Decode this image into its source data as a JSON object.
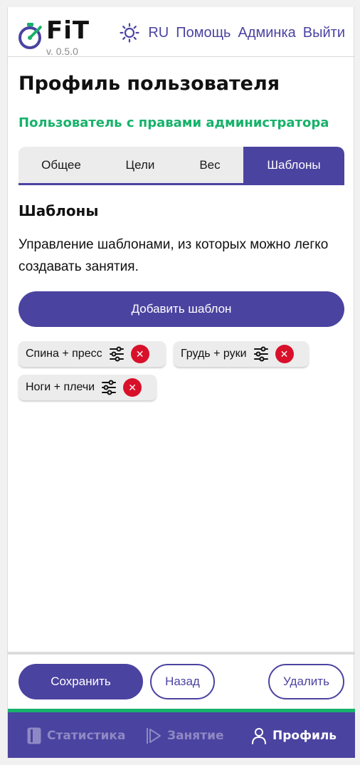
{
  "header": {
    "logo_text": "FiT",
    "version": "v. 0.5.0",
    "theme_icon": "sun-icon",
    "nav": [
      "RU",
      "Помощь",
      "Админка",
      "Выйти"
    ]
  },
  "page": {
    "title": "Профиль пользователя",
    "admin_note": "Пользователь с правами администратора"
  },
  "tabs": [
    {
      "label": "Общее",
      "active": false
    },
    {
      "label": "Цели",
      "active": false
    },
    {
      "label": "Вес",
      "active": false
    },
    {
      "label": "Шаблоны",
      "active": true
    }
  ],
  "templates_section": {
    "title": "Шаблоны",
    "description": "Управление шаблонами, из которых можно легко создавать занятия.",
    "add_button": "Добавить шаблон",
    "items": [
      {
        "name": "Спина + пресс",
        "icons": [
          "sliders-icon",
          "delete-icon"
        ]
      },
      {
        "name": "Грудь + руки",
        "icons": [
          "sliders-icon",
          "delete-icon"
        ]
      },
      {
        "name": "Ноги + плечи",
        "icons": [
          "sliders-icon",
          "delete-icon"
        ]
      }
    ]
  },
  "actions": {
    "save": "Сохранить",
    "back": "Назад",
    "delete": "Удалить"
  },
  "bottom_nav": [
    {
      "label": "Статистика",
      "icon": "book-icon",
      "active": false
    },
    {
      "label": "Занятие",
      "icon": "play-icon",
      "active": false
    },
    {
      "label": "Профиль",
      "icon": "user-icon",
      "active": true
    }
  ],
  "colors": {
    "primary": "#4b43a0",
    "accent_green": "#17b26a",
    "danger": "#d8102a",
    "chip_bg": "#ececec"
  }
}
